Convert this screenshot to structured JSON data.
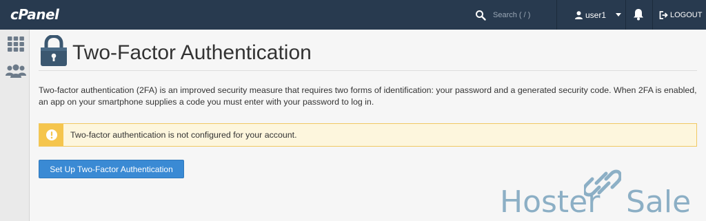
{
  "header": {
    "logo": "cPanel",
    "search_placeholder": "Search ( / )",
    "user": "user1",
    "logout": "LOGOUT"
  },
  "page": {
    "title": "Two-Factor Authentication",
    "description": "Two-factor authentication (2FA) is an improved security measure that requires two forms of identification: your password and a generated security code. When 2FA is enabled, an app on your smartphone supplies a code you must enter with your password to log in.",
    "alert": "Two-factor authentication is not configured for your account.",
    "setup_button": "Set Up Two-Factor Authentication"
  },
  "watermark": {
    "word1": "Hoster",
    "word2": "Sale"
  },
  "colors": {
    "header_bg": "#283a4f",
    "button_bg": "#3a8ad4",
    "alert_bg": "#fdf6dd",
    "alert_accent": "#f5c54d"
  },
  "icons": [
    "search-icon",
    "user-icon",
    "bell-icon",
    "logout-icon",
    "apps-grid-icon",
    "users-icon",
    "lock-icon",
    "warning-icon",
    "link-icon"
  ]
}
